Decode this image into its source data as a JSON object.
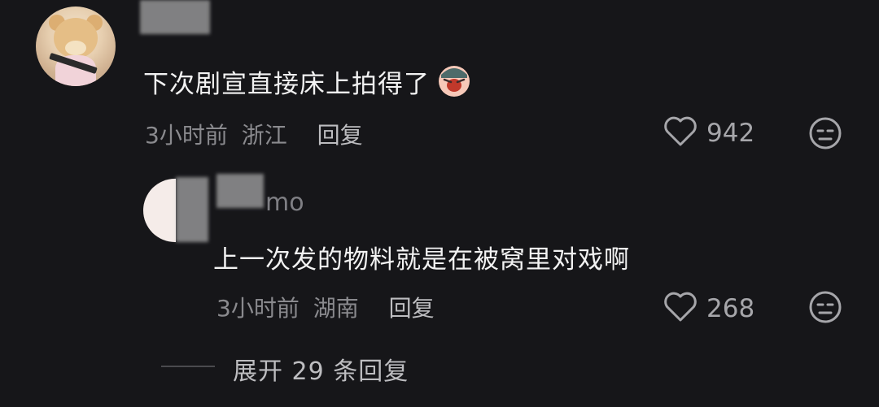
{
  "comment": {
    "text": "下次剧宣直接床上拍得了",
    "time": "3小时前",
    "location": "浙江",
    "reply_label": "回复",
    "likes": "942"
  },
  "reply": {
    "username": "mo",
    "text": "上一次发的物料就是在被窝里对戏啊",
    "time": "3小时前",
    "location": "湖南",
    "reply_label": "回复",
    "likes": "268"
  },
  "expand_label": "展开 29 条回复",
  "icons": {
    "like": "heart-outline-icon",
    "dislike": "meh-face-icon",
    "emoji": "crying-emoji-icon"
  },
  "colors": {
    "background": "#161619",
    "text_primary": "#f2f2f2",
    "text_secondary": "#8a8a8e"
  }
}
